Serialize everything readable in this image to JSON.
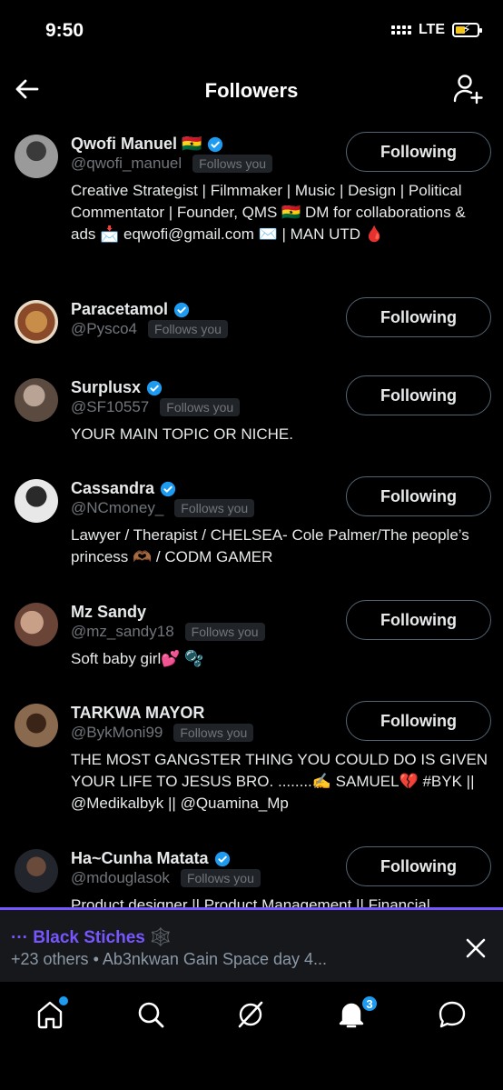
{
  "status": {
    "time": "9:50",
    "network": "LTE"
  },
  "header": {
    "title": "Followers"
  },
  "follows_you_label": "Follows you",
  "users": [
    {
      "name": "Qwofi Manuel 🇬🇭",
      "handle": "@qwofi_manuel",
      "verified": true,
      "button": "Following",
      "bio": "Creative Strategist | Filmmaker | Music | Design | Political Commentator | Founder, QMS 🇬🇭 DM for collaborations & ads 📩 eqwofi@gmail.com ✉️ | MAN UTD 🩸"
    },
    {
      "name": "Paracetamol",
      "handle": "@Pysco4",
      "verified": true,
      "button": "Following",
      "bio": ""
    },
    {
      "name": "Surplusx",
      "handle": "@SF10557",
      "verified": true,
      "button": "Following",
      "bio": "YOUR MAIN TOPIC OR NICHE."
    },
    {
      "name": "Cassandra",
      "handle": "@NCmoney_",
      "verified": true,
      "button": "Following",
      "bio": "Lawyer / Therapist / CHELSEA- Cole Palmer/The people’s princess 🫶🏾 / CODM GAMER"
    },
    {
      "name": "Mz Sandy",
      "handle": "@mz_sandy18",
      "verified": false,
      "button": "Following",
      "bio": "Soft baby girl💕 🫧"
    },
    {
      "name": "TARKWA MAYOR",
      "handle": "@BykMoni99",
      "verified": false,
      "button": "Following",
      "bio": "THE MOST GANGSTER THING YOU COULD DO IS GIVEN YOUR LIFE TO JESUS BRO. ........✍️ SAMUEL💔 #BYK || @Medikalbyk || @Quamina_Mp"
    },
    {
      "name": "Ha~Cunha Matata",
      "handle": "@mdouglasok",
      "verified": true,
      "button": "Following",
      "bio": "Product designer || Product Management || Financial"
    }
  ],
  "space": {
    "title": "··· Black Stiches 🕸️",
    "subtitle": "+23 others • Ab3nkwan Gain Space day 4..."
  },
  "tabs": {
    "notifications_count": "3"
  },
  "colors": {
    "accent": "#1d9bf0",
    "space": "#7856ff",
    "muted": "#71767b"
  }
}
